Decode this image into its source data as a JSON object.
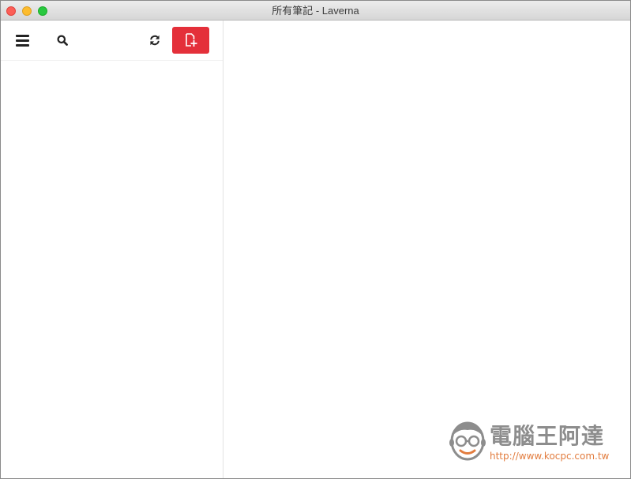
{
  "window": {
    "title": "所有筆記 - Laverna"
  },
  "toolbar": {
    "menu_icon": "hamburger-menu-icon",
    "search_icon": "search-icon",
    "sync_icon": "sync-icon",
    "new_note_icon": "new-note-icon",
    "new_note_color": "#e4303a"
  },
  "watermark": {
    "name": "電腦王阿達",
    "url": "http://www.kocpc.com.tw"
  }
}
